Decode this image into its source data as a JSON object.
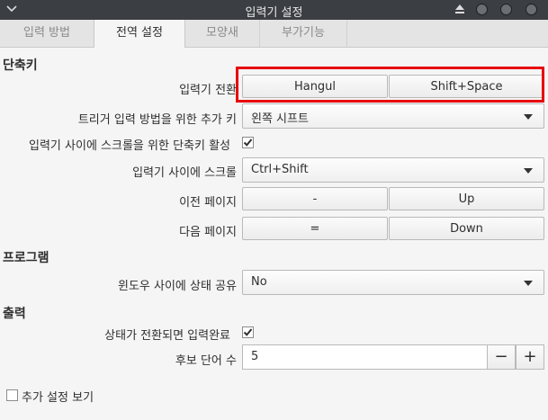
{
  "window": {
    "title": "입력기 설정"
  },
  "tabs": [
    {
      "label": "입력 방법"
    },
    {
      "label": "전역 설정"
    },
    {
      "label": "모양새"
    },
    {
      "label": "부가기능"
    }
  ],
  "sections": {
    "shortcut": "단축키",
    "program": "프로그램",
    "output": "출력"
  },
  "shortcut": {
    "toggle_label": "입력기 전환",
    "toggle_key1": "Hangul",
    "toggle_key2": "Shift+Space",
    "trigger_label": "트리거 입력 방법을 위한 추가 키",
    "trigger_value": "왼쪽 시프트",
    "scroll_enable_label": "입력기 사이에 스크롤을 위한 단축키 활성",
    "scroll_enable_checked": true,
    "scroll_label": "입력기 사이에 스크롤",
    "scroll_value": "Ctrl+Shift",
    "prev_page_label": "이전 페이지",
    "prev_page_key1": "-",
    "prev_page_key2": "Up",
    "next_page_label": "다음 페이지",
    "next_page_key1": "=",
    "next_page_key2": "Down"
  },
  "program": {
    "share_state_label": "윈도우 사이에 상태 공유",
    "share_state_value": "No"
  },
  "output": {
    "commit_on_switch_label": "상태가 전환되면 입력완료",
    "commit_on_switch_checked": true,
    "candidate_count_label": "후보 단어 수",
    "candidate_count_value": "5",
    "minus": "−",
    "plus": "+"
  },
  "footer": {
    "show_advanced_label": "추가 설정 보기",
    "show_advanced_checked": false
  },
  "colors": {
    "highlight": "#e8000b",
    "titlebar": "#3b3e42"
  }
}
